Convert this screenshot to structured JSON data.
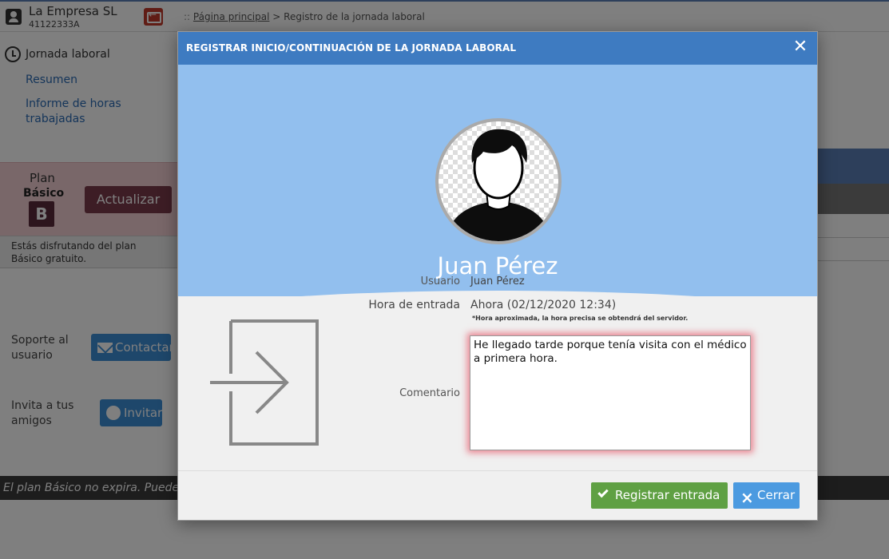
{
  "app": {
    "company_name": "La Empresa SL",
    "company_id": "41122333A",
    "breadcrumb": {
      "prefix": "::",
      "home": "Página principal",
      "separator": ">",
      "current": "Registro de la jornada laboral"
    },
    "sidebar": {
      "section_title": "Jornada laboral",
      "links": [
        "Resumen",
        "Informe de horas trabajadas"
      ]
    },
    "plan": {
      "label": "Plan",
      "name": "Básico",
      "badge": "B",
      "upgrade_label": "Actualizar",
      "note": "Estás disfrutando del plan Básico gratuito."
    },
    "support": {
      "label": "Soporte al usuario",
      "button": "Contactar"
    },
    "invite": {
      "label": "Invita a tus amigos",
      "button": "Invitar"
    },
    "bottom_banner": "El plan Básico no expira. Puedes g"
  },
  "modal": {
    "title": "REGISTRAR INICIO/CONTINUACIÓN DE LA JORNADA LABORAL",
    "close_symbol": "✕",
    "user_name": "Juan Pérez",
    "fields": {
      "user_label": "Usuario",
      "user_value": "Juan Pérez",
      "time_label": "Hora de entrada",
      "time_value": "Ahora (02/12/2020 12:34)",
      "time_note": "*Hora aproximada, la hora precisa se obtendrá del servidor.",
      "comment_label": "Comentario",
      "comment_value": "He llegado tarde porque tenía visita con el médico a primera hora."
    },
    "buttons": {
      "register": "Registrar entrada",
      "close": "Cerrar"
    }
  },
  "colors": {
    "header": "#3e7bc1",
    "hero": "#92bfee",
    "register_button": "#5fa043",
    "close_button": "#4b9ae0",
    "comment_glow": "#e63c50"
  },
  "icons": [
    "user-company-icon",
    "exit-icon",
    "history-icon",
    "mail-icon",
    "globe-icon",
    "close-icon",
    "entry-door-icon",
    "check-icon",
    "x-icon"
  ]
}
